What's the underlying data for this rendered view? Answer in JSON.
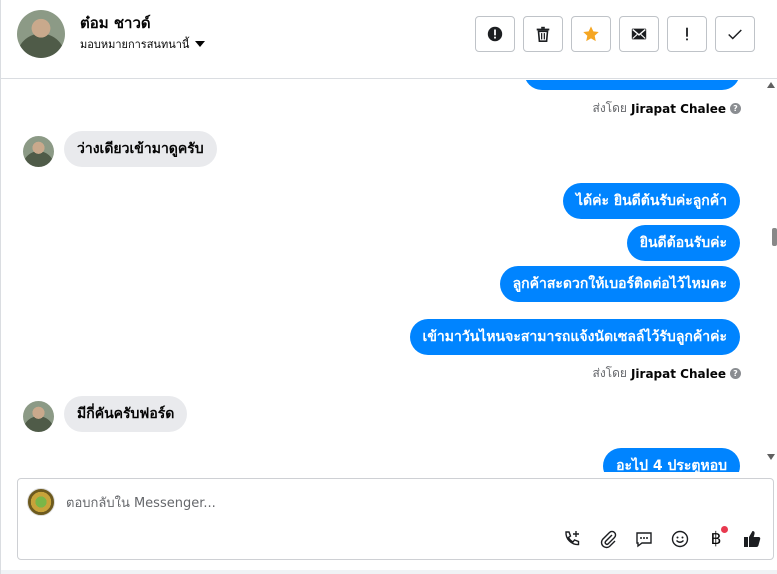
{
  "contact": {
    "name": "ต๋อม ชาวด์",
    "assign_label": "มอบหมายการสนทนานี้"
  },
  "actions": [
    {
      "name": "report-button",
      "icon": "exclamation-circle-icon"
    },
    {
      "name": "delete-button",
      "icon": "trash-icon"
    },
    {
      "name": "star-button",
      "icon": "star-icon",
      "color": "#f5a623"
    },
    {
      "name": "mark-unread-button",
      "icon": "envelope-icon"
    },
    {
      "name": "follow-up-button",
      "icon": "exclamation-icon"
    },
    {
      "name": "mark-done-button",
      "icon": "check-icon"
    }
  ],
  "messages": {
    "sent_by_prefix": "ส่งโดย",
    "agent_name": "Jirapat Chalee",
    "in_1": "ว่างเดียวเข้ามาดูครับ",
    "out_1": "ได้ค่ะ ยินดีต้นรับค่ะลูกค้า",
    "out_2": "ยินดีต้อนรับค่ะ",
    "out_3": "ลูกค้าสะดวกให้เบอร์ติดต่อไว้ไหมคะ",
    "out_4": "เข้ามาวันไหนจะสามารถแจ้งนัดเซลล์ไว้รับลูกค้าค่ะ",
    "in_2": "มีกี่คันครับฟอร์ด",
    "out_5_partial": "อะไป 4 ประตูหอบ"
  },
  "composer": {
    "placeholder": "ตอบกลับใน Messenger..."
  },
  "colors": {
    "outgoing_bubble": "#0084ff",
    "incoming_bubble": "#e9eaed",
    "badge_dot": "#e8394f"
  }
}
